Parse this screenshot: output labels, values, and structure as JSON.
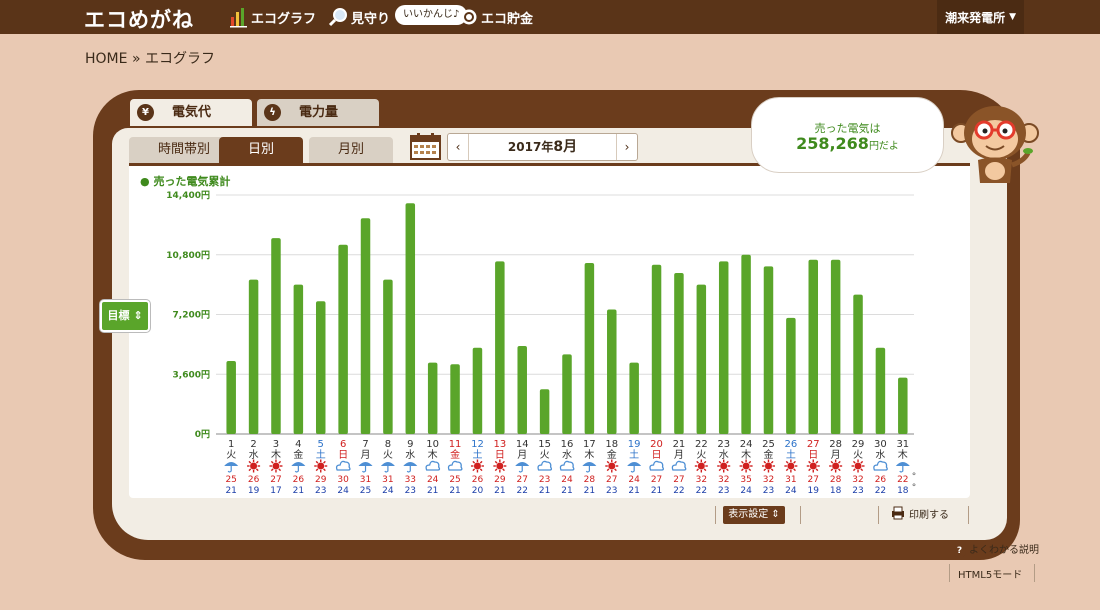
{
  "app": {
    "logo": "エコめがね",
    "plant": "潮来発電所"
  },
  "nav": {
    "graph": "エコグラフ",
    "watch": "見守り",
    "bubble": "いいかんじ♪",
    "savings": "エコ貯金"
  },
  "breadcrumb": {
    "home": "HOME",
    "sep": "»",
    "current": "エコグラフ"
  },
  "main_tabs": [
    {
      "label": "電気代",
      "icon": "yen-icon"
    },
    {
      "label": "電力量",
      "icon": "lightning-icon"
    }
  ],
  "sub_tabs": [
    {
      "label": "時間帯別"
    },
    {
      "label": "日別",
      "selected": true
    },
    {
      "label": "月別"
    }
  ],
  "date": {
    "year": "2017年",
    "month": "8月",
    "prev": "‹",
    "next": "›"
  },
  "summary": {
    "line1": "売った電気は",
    "amount": "258,268",
    "suffix": "円だよ"
  },
  "target_button": "目標",
  "buttons": {
    "display_settings": "表示設定",
    "print": "印刷する",
    "help": "よくわかる説明",
    "html5": "HTML5モード"
  },
  "colors": {
    "bar": "#5aa52a",
    "brown": "#6b3c1c",
    "saturday": "#2d73c9",
    "sunday": "#d0201f",
    "high_temp": "#d0201f",
    "low_temp": "#1d3fa8"
  },
  "chart_data": {
    "type": "bar",
    "title": "売った電気累計",
    "y_unit": "円",
    "ylim": [
      0,
      14400
    ],
    "yticks": [
      "0円",
      "3,600円",
      "7,200円",
      "10,800円",
      "14,400円"
    ],
    "grid": true,
    "categories": [
      "1",
      "2",
      "3",
      "4",
      "5",
      "6",
      "7",
      "8",
      "9",
      "10",
      "11",
      "12",
      "13",
      "14",
      "15",
      "16",
      "17",
      "18",
      "19",
      "20",
      "21",
      "22",
      "23",
      "24",
      "25",
      "26",
      "27",
      "28",
      "29",
      "30",
      "31"
    ],
    "weekdays": [
      "火",
      "水",
      "木",
      "金",
      "土",
      "日",
      "月",
      "火",
      "水",
      "木",
      "金",
      "土",
      "日",
      "月",
      "火",
      "水",
      "木",
      "金",
      "土",
      "日",
      "月",
      "火",
      "水",
      "木",
      "金",
      "土",
      "日",
      "月",
      "火",
      "水",
      "木"
    ],
    "holidays": [
      11
    ],
    "weather": [
      "rain",
      "sun",
      "sun",
      "rain",
      "sun",
      "cloud",
      "rain",
      "rain",
      "rain",
      "cloud",
      "cloud",
      "sun",
      "sun",
      "rain",
      "cloud",
      "cloud",
      "rain",
      "sun",
      "rain",
      "cloud",
      "cloud",
      "sun",
      "sun",
      "sun",
      "sun",
      "sun",
      "sun",
      "sun",
      "sun",
      "cloud",
      "rain"
    ],
    "high_temps": [
      25,
      26,
      27,
      26,
      29,
      30,
      31,
      31,
      33,
      24,
      25,
      26,
      29,
      27,
      23,
      24,
      28,
      27,
      24,
      27,
      27,
      32,
      32,
      35,
      32,
      31,
      27,
      28,
      32,
      26,
      22
    ],
    "low_temps": [
      21,
      19,
      17,
      21,
      23,
      24,
      25,
      24,
      23,
      21,
      21,
      20,
      21,
      22,
      21,
      21,
      21,
      23,
      21,
      21,
      22,
      22,
      23,
      24,
      23,
      24,
      19,
      18,
      23,
      22,
      18
    ],
    "temp_unit": "°",
    "values": [
      4400,
      9300,
      11800,
      9000,
      8000,
      11400,
      13000,
      9300,
      13900,
      4300,
      4200,
      5200,
      10400,
      5300,
      2700,
      4800,
      10300,
      7500,
      4300,
      10200,
      9700,
      9000,
      10400,
      10800,
      10100,
      7000,
      10500,
      10500,
      8400,
      5200,
      3400
    ]
  }
}
